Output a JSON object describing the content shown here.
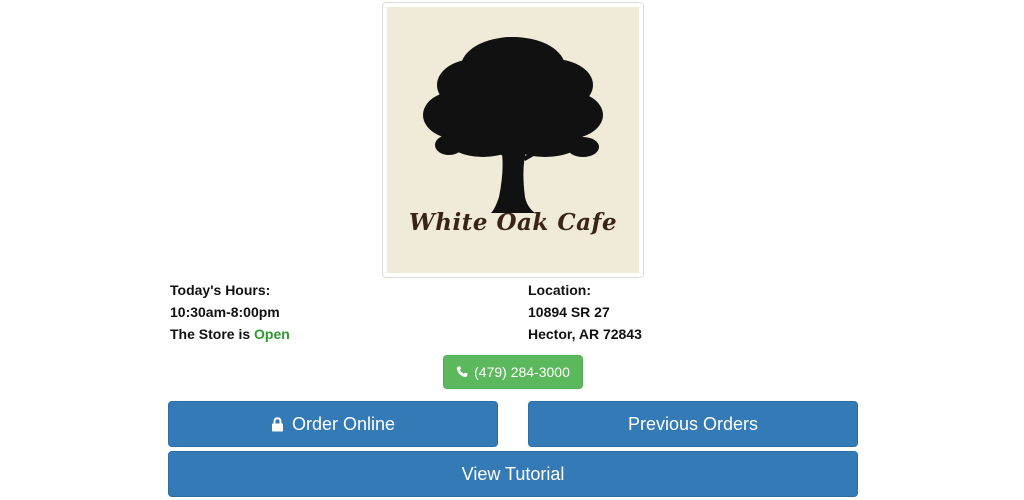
{
  "logo": {
    "name": "White Oak Cafe",
    "icon": "oak-tree-icon"
  },
  "hours": {
    "label": "Today's Hours:",
    "value": "10:30am-8:00pm",
    "status_prefix": "The Store is",
    "status": "Open",
    "status_color": "#2e9a2e"
  },
  "location": {
    "label": "Location:",
    "street": "10894 SR 27",
    "city": "Hector, AR 72843"
  },
  "phone": {
    "icon": "phone-icon",
    "label": "(479) 284-3000",
    "color": "#5cb85c"
  },
  "actions": {
    "order_online": {
      "label": "Order Online",
      "icon": "lock-icon"
    },
    "previous_orders": {
      "label": "Previous Orders"
    },
    "view_tutorial": {
      "label": "View Tutorial"
    },
    "color": "#337ab7"
  }
}
